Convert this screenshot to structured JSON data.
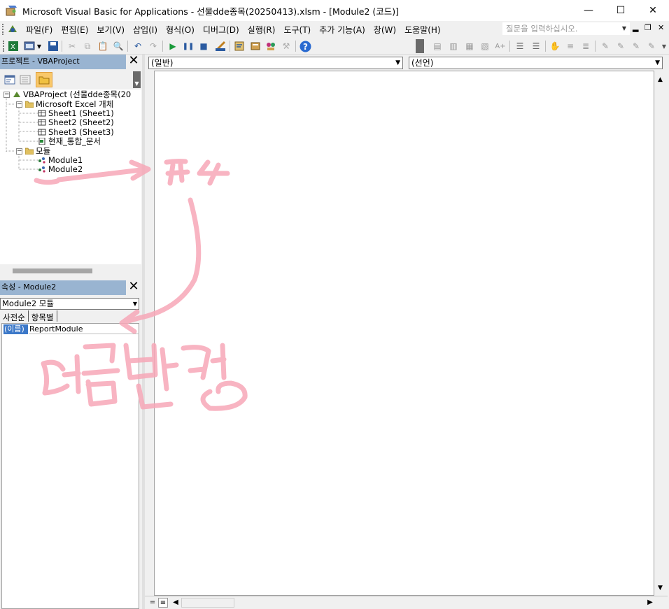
{
  "window": {
    "title": "Microsoft Visual Basic for Applications - 선물dde종목(20250413).xlsm - [Module2 (코드)]",
    "minimize": "—",
    "maximize": "☐",
    "close": "✕"
  },
  "menubar": {
    "items": [
      {
        "label": "파일(F)"
      },
      {
        "label": "편집(E)"
      },
      {
        "label": "보기(V)"
      },
      {
        "label": "삽입(I)"
      },
      {
        "label": "형식(O)"
      },
      {
        "label": "디버그(D)"
      },
      {
        "label": "실행(R)"
      },
      {
        "label": "도구(T)"
      },
      {
        "label": "추가 기능(A)"
      },
      {
        "label": "창(W)"
      },
      {
        "label": "도움말(H)"
      }
    ],
    "help_placeholder": "질문을 입력하십시오.",
    "mdi_minimize": "▂",
    "mdi_restore": "❐",
    "mdi_close": "✕"
  },
  "project_panel": {
    "title": "프로젝트 - VBAProject",
    "close": "✕",
    "tree": {
      "root": "VBAProject (선물dde종목(20",
      "excel_objects": "Microsoft Excel 개체",
      "sheets": [
        "Sheet1 (Sheet1)",
        "Sheet2 (Sheet2)",
        "Sheet3 (Sheet3)"
      ],
      "workbook": "현재_통합_문서",
      "modules_folder": "모듈",
      "modules": [
        "Module1",
        "Module2"
      ]
    }
  },
  "properties_panel": {
    "title": "속성 - Module2",
    "close": "✕",
    "object_combo": "Module2 모듈",
    "tabs": [
      "사전순",
      "항목별"
    ],
    "property_name": "(이름)",
    "property_value": "ReportModule"
  },
  "code_window": {
    "object_combo": "(일반)",
    "procedure_combo": "(선언)"
  },
  "annotation": {
    "text": "이름변경",
    "colors": {
      "ink": "#f7a8b8"
    }
  },
  "colors": {
    "panel_header": "#99b4d1",
    "selection": "#3c78c8"
  }
}
